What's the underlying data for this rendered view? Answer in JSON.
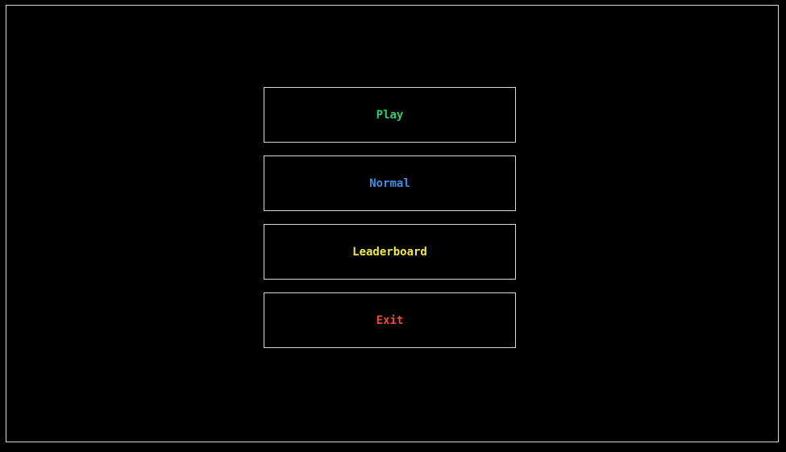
{
  "menu": {
    "items": [
      {
        "label": "Play",
        "color": "#2ecc71"
      },
      {
        "label": "Normal",
        "color": "#3b8ee8"
      },
      {
        "label": "Leaderboard",
        "color": "#f1e84a"
      },
      {
        "label": "Exit",
        "color": "#e74c3c"
      }
    ]
  }
}
